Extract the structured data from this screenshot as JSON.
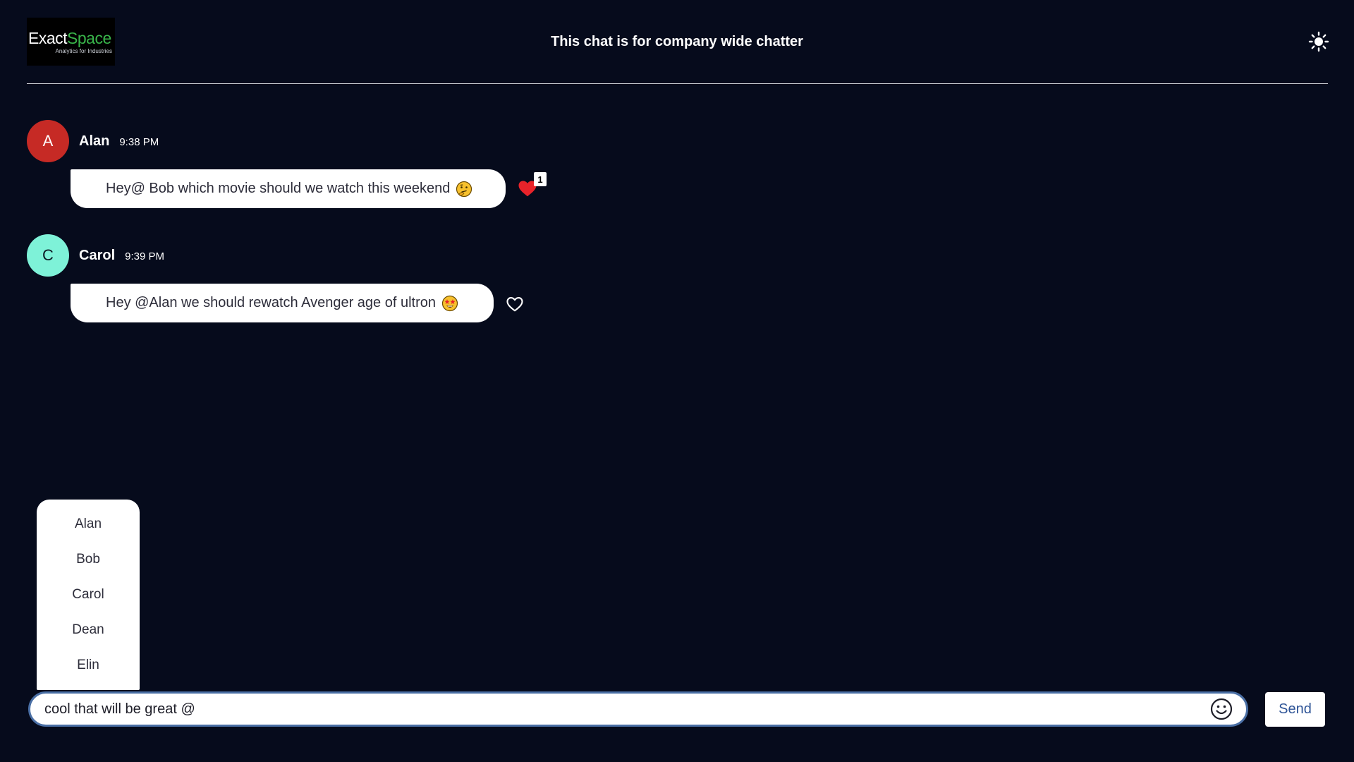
{
  "header": {
    "logo": {
      "word_part1": "Exact",
      "word_part2": "Space",
      "tagline": "Analytics for Industries"
    },
    "title": "This chat is for company wide chatter",
    "theme_icon": "sun-icon"
  },
  "messages": [
    {
      "author": "Alan",
      "initial": "A",
      "time": "9:38 PM",
      "text": "Hey@ Bob which movie should we watch this weekend",
      "emoji": "thinking-face",
      "liked": true,
      "likes": "1",
      "avatar_color": "#c62a25"
    },
    {
      "author": "Carol",
      "initial": "C",
      "time": "9:39 PM",
      "text": "Hey @Alan we should rewatch Avenger age of ultron",
      "emoji": "star-struck-face",
      "liked": false,
      "avatar_color": "#7ef2d8"
    }
  ],
  "mention_list": [
    "Alan",
    "Bob",
    "Carol",
    "Dean",
    "Elin"
  ],
  "composer": {
    "value": "cool that will be great @",
    "emoji_icon": "smiley-icon",
    "send_label": "Send"
  },
  "colors": {
    "background": "#060b1c",
    "accent": "#4a6fa5",
    "send_text": "#2f5597",
    "like": "#e8232a"
  }
}
